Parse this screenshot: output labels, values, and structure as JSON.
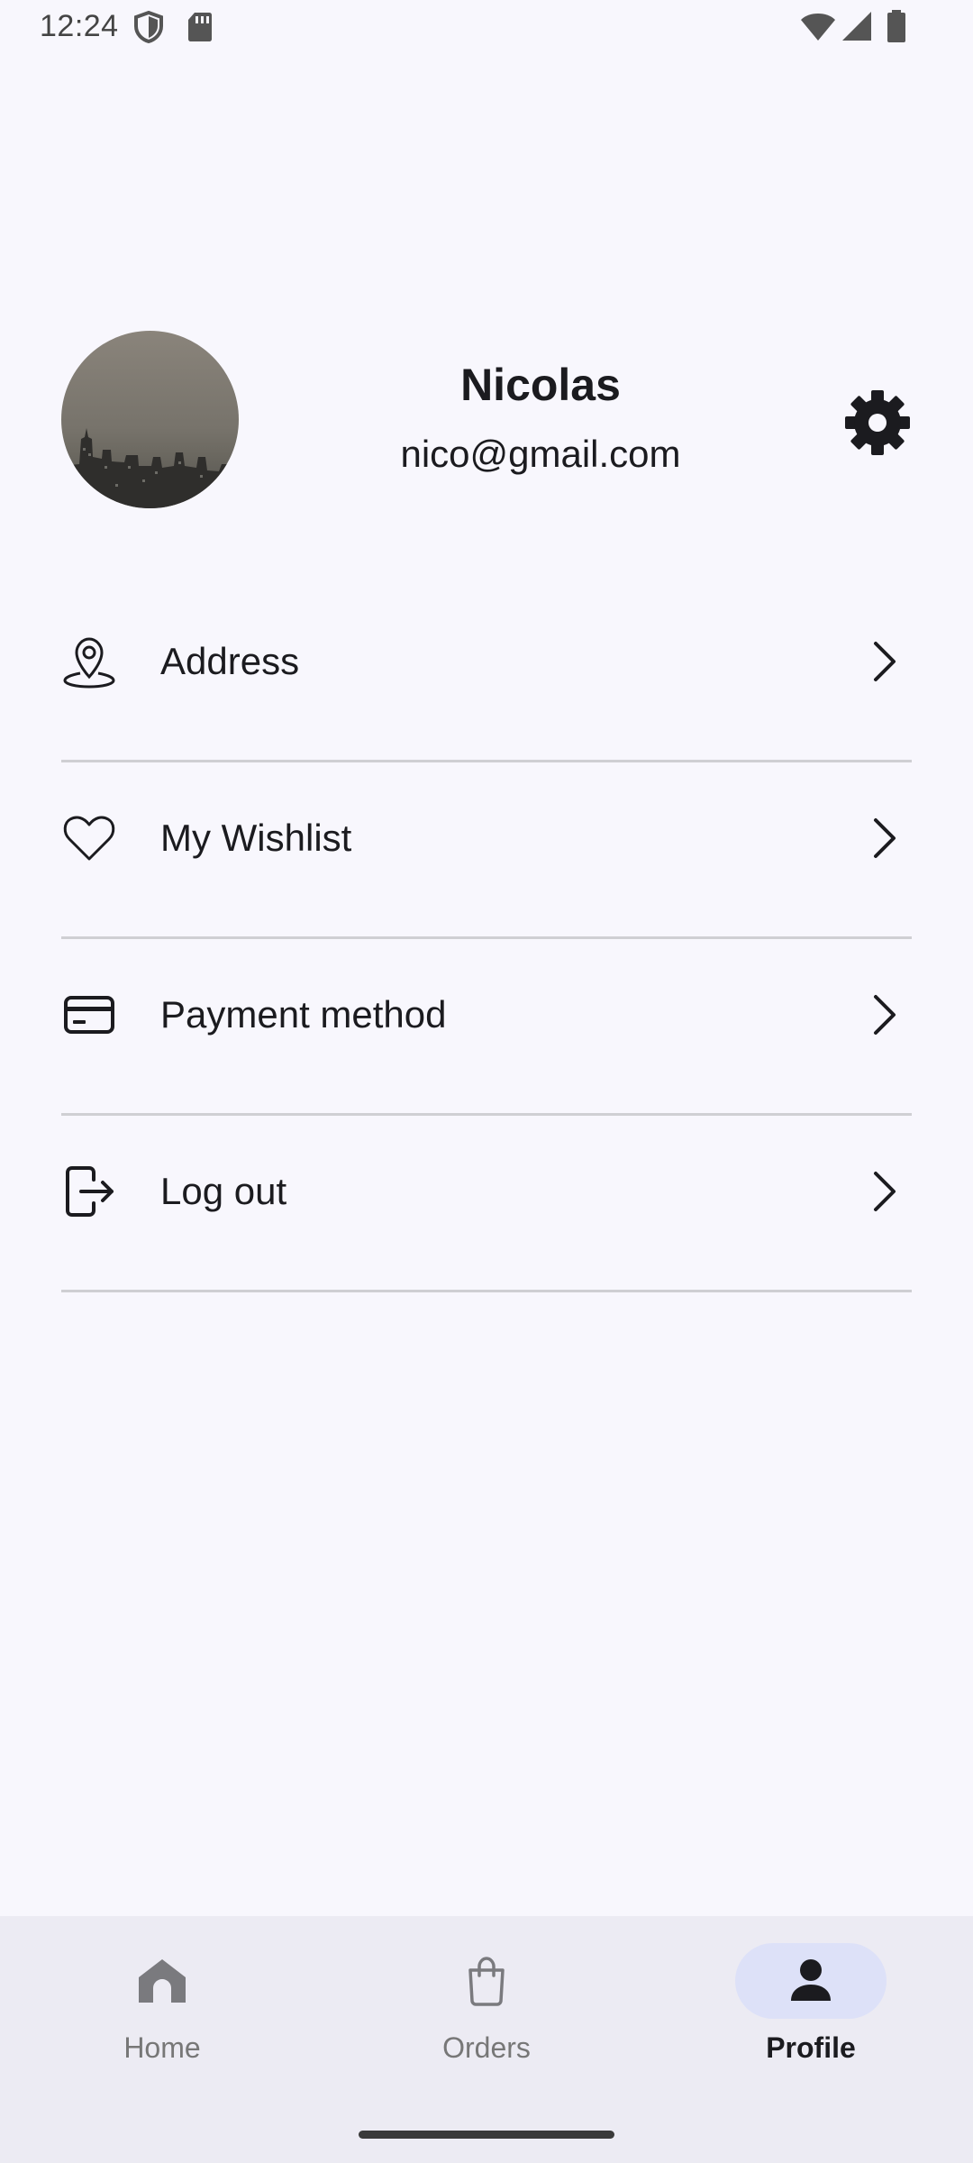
{
  "status_bar": {
    "time": "12:24",
    "left_icons": [
      "shield-icon",
      "sd-card-icon"
    ],
    "right_icons": [
      "wifi-icon",
      "signal-icon",
      "battery-icon"
    ]
  },
  "profile": {
    "name": "Nicolas",
    "email": "nico@gmail.com",
    "settings_icon": "gear-icon"
  },
  "menu": {
    "items": [
      {
        "label": "Address",
        "icon": "location-pin-icon"
      },
      {
        "label": "My Wishlist",
        "icon": "heart-icon"
      },
      {
        "label": "Payment method",
        "icon": "credit-card-icon"
      },
      {
        "label": "Log out",
        "icon": "logout-icon"
      }
    ]
  },
  "bottom_nav": {
    "items": [
      {
        "label": "Home",
        "icon": "home-icon",
        "active": false
      },
      {
        "label": "Orders",
        "icon": "shopping-bag-icon",
        "active": false
      },
      {
        "label": "Profile",
        "icon": "person-icon",
        "active": true
      }
    ]
  },
  "colors": {
    "background": "#f8f7fd",
    "nav_background": "#ecebf3",
    "active_pill": "#dde1f8",
    "divider": "#cfcfd3",
    "text": "#1b1b1f",
    "inactive_text": "#777777"
  }
}
